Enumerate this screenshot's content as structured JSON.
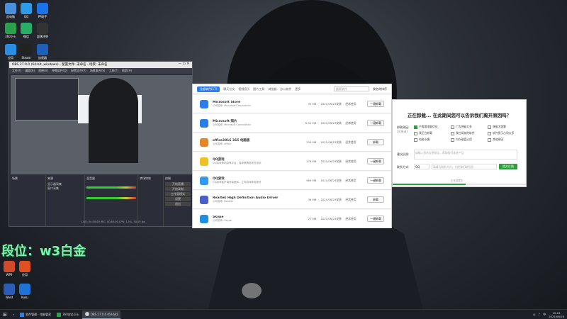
{
  "desktop": {
    "rank_overlay": "段位：w3白金",
    "icons": [
      {
        "label": "此电脑",
        "color": "#4a8fd9"
      },
      {
        "label": "QQ",
        "color": "#2e9be8"
      },
      {
        "label": "PP助手",
        "color": "#1a73e8"
      },
      {
        "label": "360卫士",
        "color": "#2aa14a"
      },
      {
        "label": "微信",
        "color": "#2aae67"
      },
      {
        "label": "部落冲突",
        "color": "#333"
      },
      {
        "label": "应用",
        "color": "#2a8de2"
      },
      {
        "label": "Steam",
        "color": "#222"
      },
      {
        "label": "加速器",
        "color": "#1e5fb8"
      },
      {
        "label": "WPS",
        "color": "#d14a2a"
      },
      {
        "label": "应用",
        "color": "#e05020"
      },
      {
        "label": "Word",
        "color": "#2b5db6"
      },
      {
        "label": "Kuku",
        "color": "#1d73d8"
      }
    ]
  },
  "obs": {
    "title": "OBS 27.0.0 (64-bit, windows) - 配置文件: 未命名 - 场景: 未命名",
    "menu": [
      "文件(F)",
      "编辑(E)",
      "视图(V)",
      "停靠部件(D)",
      "配置文件(P)",
      "场景集合(S)",
      "工具(T)",
      "帮助(H)"
    ],
    "docks": {
      "scenes": "场景",
      "sources": "来源",
      "mixer": "混音器",
      "transitions": "转场特效",
      "controls": "控制"
    },
    "sources": [
      "显示器采集",
      "窗口采集"
    ],
    "controls": [
      "开始直播",
      "开始录制",
      "工作室模式",
      "设置",
      "退出"
    ],
    "status": "LIVE: 00:00:00  REC: 00:00:00  CPU: 1.5%, 30.00 fps"
  },
  "uninstaller": {
    "tabs": [
      "全部软件(17)",
      "聊天社交",
      "视频音乐",
      "图片工具",
      "浏览器",
      "办公软件",
      "更多"
    ],
    "search": "搜索软件",
    "sort": "按名称排序",
    "rows": [
      {
        "name": "Microsoft Store",
        "desc": "公司名称: Microsoft Corporation",
        "size": "35 MB",
        "date": "2021/06/23安装",
        "freq": "经常使用",
        "btn": "一键卸载",
        "color": "#2b7de9"
      },
      {
        "name": "Microsoft 照片",
        "desc": "公司名称: Microsoft Corporation",
        "size": "2.52 MB",
        "date": "2021/06/23安装",
        "freq": "经常使用",
        "btn": "一键卸载",
        "color": "#2b7de9"
      },
      {
        "name": "office2016 365 电脑版",
        "desc": "公司名称: office",
        "size": "234 MB",
        "date": "2021/06/23安装",
        "freq": "经常使用",
        "btn": "卸载",
        "color": "#e8852b"
      },
      {
        "name": "QQ游戏",
        "desc": "QQ游戏休闲游戏平台，各种棋牌游戏在线玩",
        "size": "176 MB",
        "date": "2021/06/23安装",
        "freq": "经常使用",
        "btn": "一键卸载",
        "color": "#f0c020"
      },
      {
        "name": "QQ游戏",
        "desc": "QQ游戏客户端安装程序，让你游戏体验更好",
        "size": "569 MB",
        "date": "2021/06/23安装",
        "freq": "经常使用",
        "btn": "一键卸载",
        "color": "#3399ee"
      },
      {
        "name": "Realtek High Definition Audio Driver",
        "desc": "公司名称: Realtek",
        "size": "36 MB",
        "date": "2021/06/23安装",
        "freq": "经常使用",
        "btn": "卸载",
        "color": "#4a60c8"
      },
      {
        "name": "Skype",
        "desc": "公司名称: Skype",
        "size": "27 MB",
        "date": "2021/06/23安装",
        "freq": "经常使用",
        "btn": "一键卸载",
        "color": "#1f8fe0"
      }
    ]
  },
  "survey": {
    "heading": "正在卸载... 在此期间您可以告诉我们离开原因吗？",
    "reason_label": "卸载原因:",
    "reason_note": "(可多选)",
    "options": [
      "不需要电脑优化",
      "广告弹窗太多",
      "弹窗太频繁",
      "我正在卸载",
      "我在用其他软件",
      "软件提示占用太多",
      "电脑卡慢",
      "内存磁盘占用",
      "其他原因"
    ],
    "suggest_label": "建议反馈:",
    "suggest_placeholder": "请输入您的宝贵意见，帮助我们改进产品",
    "contact_label": "联系方式:",
    "contact_type": "QQ",
    "contact_placeholder": "请填写联系方式，方便我们联系您",
    "submit": "提交反馈",
    "progress_text": "正在卸载中"
  },
  "taskbar": {
    "items": [
      "软件管理 - 电脑管家",
      "360安全卫士",
      "OBS 27.0.0 (64-bit)"
    ],
    "time": "15:24",
    "date": "2021/06/28",
    "ime": "中"
  }
}
